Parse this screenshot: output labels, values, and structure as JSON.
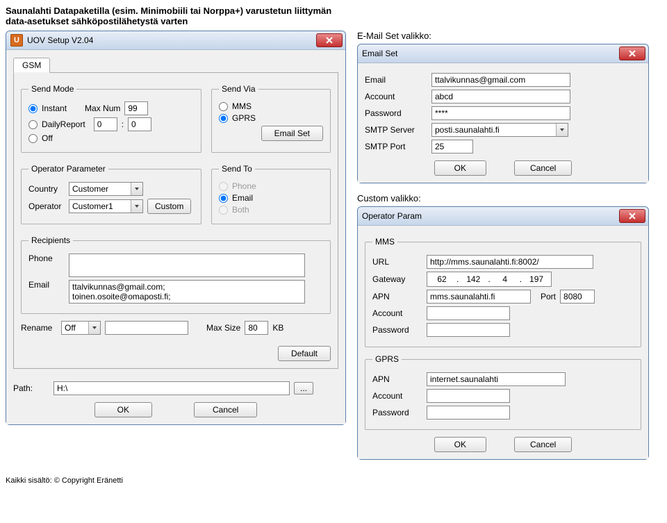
{
  "page": {
    "intro_line1": "Saunalahti Datapaketilla (esim. Minimobiili tai Norppa+) varustetun liittymän",
    "intro_line2": "data-asetukset sähköpostilähetystä varten"
  },
  "uov": {
    "title": "UOV Setup V2.04",
    "tab_gsm": "GSM",
    "send_mode": {
      "legend": "Send Mode",
      "instant": "Instant",
      "daily": "DailyReport",
      "off": "Off",
      "max_num_label": "Max Num",
      "max_num_value": "99",
      "daily_h": "0",
      "daily_m": "0"
    },
    "send_via": {
      "legend": "Send Via",
      "mms": "MMS",
      "gprs": "GPRS",
      "email_set_btn": "Email Set"
    },
    "operator": {
      "legend": "Operator Parameter",
      "country_label": "Country",
      "country_value": "Customer",
      "operator_label": "Operator",
      "operator_value": "Customer1",
      "custom_btn": "Custom"
    },
    "send_to": {
      "legend": "Send To",
      "phone": "Phone",
      "email": "Email",
      "both": "Both"
    },
    "recipients": {
      "legend": "Recipients",
      "phone_label": "Phone",
      "phone_value": "",
      "email_label": "Email",
      "email_value": "ttalvikunnas@gmail.com;\ntoinen.osoite@omaposti.fi;"
    },
    "rename_label": "Rename",
    "rename_value": "Off",
    "rename_text": "",
    "max_size_label": "Max Size",
    "max_size_value": "80",
    "max_size_unit": "KB",
    "default_btn": "Default",
    "path_label": "Path:",
    "path_value": "H:\\",
    "ok_btn": "OK",
    "cancel_btn": "Cancel"
  },
  "right_labels": {
    "email_set": "E-Mail Set valikko:",
    "custom": "Custom valikko:"
  },
  "email_set": {
    "title": "Email Set",
    "email_label": "Email",
    "email_value": "ttalvikunnas@gmail.com",
    "account_label": "Account",
    "account_value": "abcd",
    "password_label": "Password",
    "password_value": "****",
    "smtp_server_label": "SMTP Server",
    "smtp_server_value": "posti.saunalahti.fi",
    "smtp_port_label": "SMTP Port",
    "smtp_port_value": "25",
    "ok_btn": "OK",
    "cancel_btn": "Cancel"
  },
  "operator_param": {
    "title": "Operator Param",
    "mms": {
      "legend": "MMS",
      "url_label": "URL",
      "url_value": "http://mms.saunalahti.fi:8002/",
      "gateway_label": "Gateway",
      "gateway_ip": [
        "62",
        "142",
        "4",
        "197"
      ],
      "apn_label": "APN",
      "apn_value": "mms.saunalahti.fi",
      "port_label": "Port",
      "port_value": "8080",
      "account_label": "Account",
      "account_value": "",
      "password_label": "Password",
      "password_value": ""
    },
    "gprs": {
      "legend": "GPRS",
      "apn_label": "APN",
      "apn_value": "internet.saunalahti",
      "account_label": "Account",
      "account_value": "",
      "password_label": "Password",
      "password_value": ""
    },
    "ok_btn": "OK",
    "cancel_btn": "Cancel"
  },
  "footer": "Kaikki sisältö: © Copyright Eränetti"
}
